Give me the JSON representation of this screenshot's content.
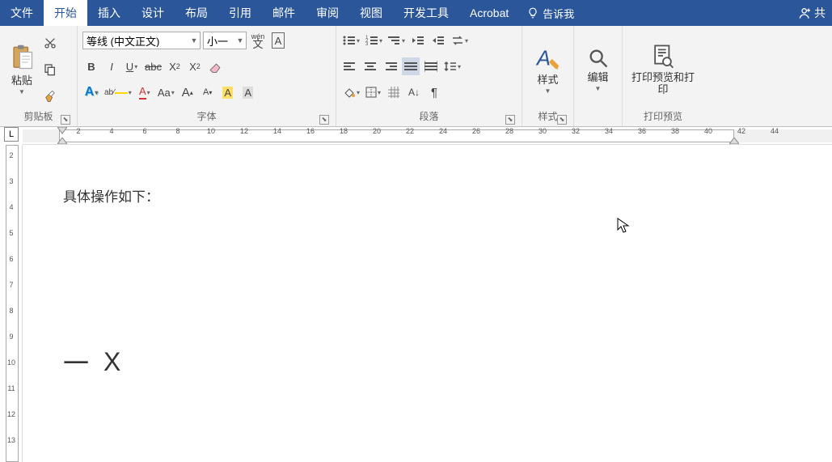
{
  "tabs": [
    "文件",
    "开始",
    "插入",
    "设计",
    "布局",
    "引用",
    "邮件",
    "审阅",
    "视图",
    "开发工具",
    "Acrobat"
  ],
  "active_tab": 1,
  "tellme": "告诉我",
  "share": "共",
  "clipboard": {
    "label": "剪贴板",
    "paste": "粘贴"
  },
  "font": {
    "label": "字体",
    "name": "等线 (中文正文)",
    "size": "小一",
    "wen": "wén",
    "wenchar": "文",
    "A": "A"
  },
  "paragraph": {
    "label": "段落"
  },
  "styles": {
    "label": "样式",
    "button": "样式"
  },
  "editing": {
    "label": "编辑"
  },
  "print": {
    "label": "打印预览",
    "button": "打印预览和打印"
  },
  "doc": {
    "line1": "具体操作如下：",
    "heading_num": "一",
    "heading_text": "X"
  },
  "ruler_h": [
    2,
    4,
    6,
    8,
    10,
    12,
    14,
    16,
    18,
    20,
    22,
    24,
    26,
    28,
    30,
    32,
    34,
    36,
    38,
    40,
    42,
    44
  ],
  "ruler_v": [
    2,
    3,
    4,
    5,
    6,
    7,
    8,
    9,
    10,
    11,
    12,
    13
  ]
}
